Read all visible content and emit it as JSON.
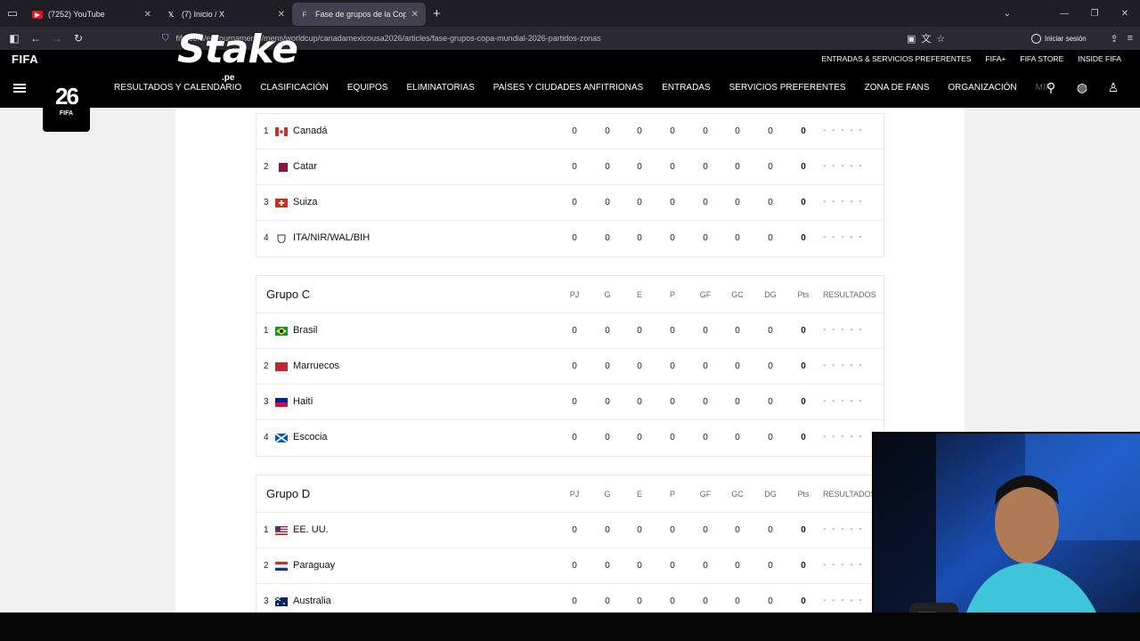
{
  "browser": {
    "tabs": [
      {
        "title": "(7252) YouTube",
        "icon": "youtube-icon",
        "active": false
      },
      {
        "title": "(7) Inicio / X",
        "icon": "x-icon",
        "active": false
      },
      {
        "title": "Fase de grupos de la Copa Mun",
        "icon": "fifa-icon",
        "active": true
      }
    ],
    "url": "fifa.com/es/tournaments/mens/worldcup/canadamexicousa2026/articles/fase-grupos-copa-mundial-2026-partidos-zonas",
    "signin_label": "Iniciar sesión"
  },
  "overlay": {
    "brand": "Stake",
    "suffix": ".pe"
  },
  "fifa": {
    "logo": "FIFA",
    "top_links": [
      "ENTRADAS & SERVICIOS PREFERENTES",
      "FIFA+",
      "FIFA STORE",
      "INSIDE FIFA"
    ],
    "badge_text": "FIFA",
    "badge_number": "26",
    "menu": [
      "RESULTADOS Y CALENDARIO",
      "CLASIFICACIÓN",
      "EQUIPOS",
      "ELIMINATORIAS",
      "PAÍSES Y CIUDADES ANFITRIONAS",
      "ENTRADAS",
      "SERVICIOS PREFERENTES",
      "ZONA DE FANS",
      "ORGANIZACIÓN",
      "MIR"
    ]
  },
  "columns": [
    "PJ",
    "G",
    "E",
    "P",
    "GF",
    "GC",
    "DG",
    "Pts",
    "RESULTADOS"
  ],
  "groups": [
    {
      "name": "",
      "rows": [
        {
          "pos": "1",
          "team": "Canadá",
          "flag": "canada",
          "stats": [
            "0",
            "0",
            "0",
            "0",
            "0",
            "0",
            "0",
            "0"
          ],
          "res": "- - - - -"
        },
        {
          "pos": "2",
          "team": "Catar",
          "flag": "qatar",
          "stats": [
            "0",
            "0",
            "0",
            "0",
            "0",
            "0",
            "0",
            "0"
          ],
          "res": "- - - - -"
        },
        {
          "pos": "3",
          "team": "Suiza",
          "flag": "switzerland",
          "stats": [
            "0",
            "0",
            "0",
            "0",
            "0",
            "0",
            "0",
            "0"
          ],
          "res": "- - - - -"
        },
        {
          "pos": "4",
          "team": "ITA/NIR/WAL/BIH",
          "flag": "shield",
          "stats": [
            "0",
            "0",
            "0",
            "0",
            "0",
            "0",
            "0",
            "0"
          ],
          "res": "- - - - -"
        }
      ]
    },
    {
      "name": "Grupo C",
      "rows": [
        {
          "pos": "1",
          "team": "Brasil",
          "flag": "brazil",
          "stats": [
            "0",
            "0",
            "0",
            "0",
            "0",
            "0",
            "0",
            "0"
          ],
          "res": "- - - - -"
        },
        {
          "pos": "2",
          "team": "Marruecos",
          "flag": "morocco",
          "stats": [
            "0",
            "0",
            "0",
            "0",
            "0",
            "0",
            "0",
            "0"
          ],
          "res": "- - - - -"
        },
        {
          "pos": "3",
          "team": "Haití",
          "flag": "haiti",
          "stats": [
            "0",
            "0",
            "0",
            "0",
            "0",
            "0",
            "0",
            "0"
          ],
          "res": "- - - - -"
        },
        {
          "pos": "4",
          "team": "Escocia",
          "flag": "scotland",
          "stats": [
            "0",
            "0",
            "0",
            "0",
            "0",
            "0",
            "0",
            "0"
          ],
          "res": "- - - - -"
        }
      ]
    },
    {
      "name": "Grupo D",
      "rows": [
        {
          "pos": "1",
          "team": "EE. UU.",
          "flag": "usa",
          "stats": [
            "0",
            "0",
            "0",
            "0",
            "0",
            "0",
            "0",
            "0"
          ],
          "res": "- - - - -"
        },
        {
          "pos": "2",
          "team": "Paraguay",
          "flag": "paraguay",
          "stats": [
            "0",
            "0",
            "0",
            "0",
            "0",
            "0",
            "0",
            "0"
          ],
          "res": "- - - - -"
        },
        {
          "pos": "3",
          "team": "Australia",
          "flag": "australia",
          "stats": [
            "0",
            "0",
            "0",
            "0",
            "0",
            "0",
            "0",
            "0"
          ],
          "res": "- - - - -"
        }
      ]
    }
  ],
  "colors": {
    "fifa_black": "#000000",
    "page_bg": "#f1f1f1",
    "browser_bg": "#1f1e25"
  }
}
